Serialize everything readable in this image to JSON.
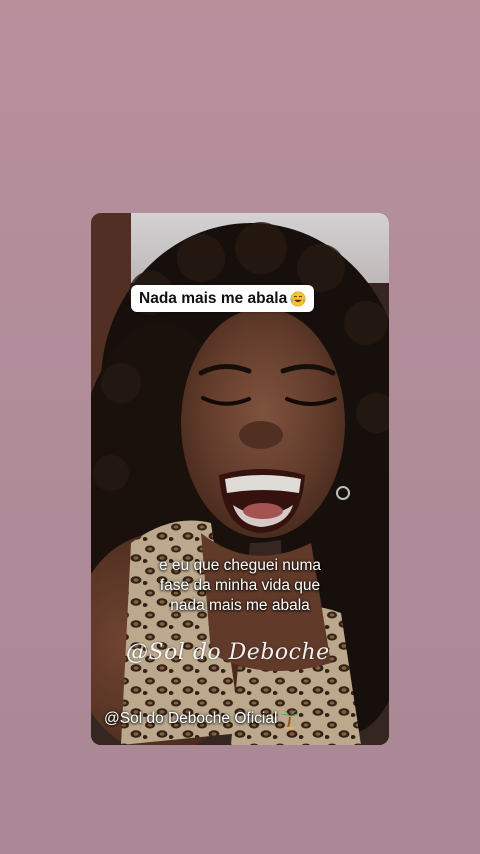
{
  "story": {
    "caption_sticker": {
      "text": "Nada mais me abala",
      "emoji": "face-with-tears-of-joy-icon"
    },
    "subtitle_lines": [
      "e eu que cheguei numa",
      "fase da minha vida que",
      "nada mais me abala"
    ],
    "watermark": "@Sol do Deboche",
    "handle": {
      "text": "@Sol do Deboche Oficial",
      "emoji": "palm-tree-icon"
    }
  },
  "colors": {
    "background": "#b28f9c",
    "sticker_bg": "#ffffff",
    "text_light": "#ffffff",
    "text_dark": "#111111"
  }
}
